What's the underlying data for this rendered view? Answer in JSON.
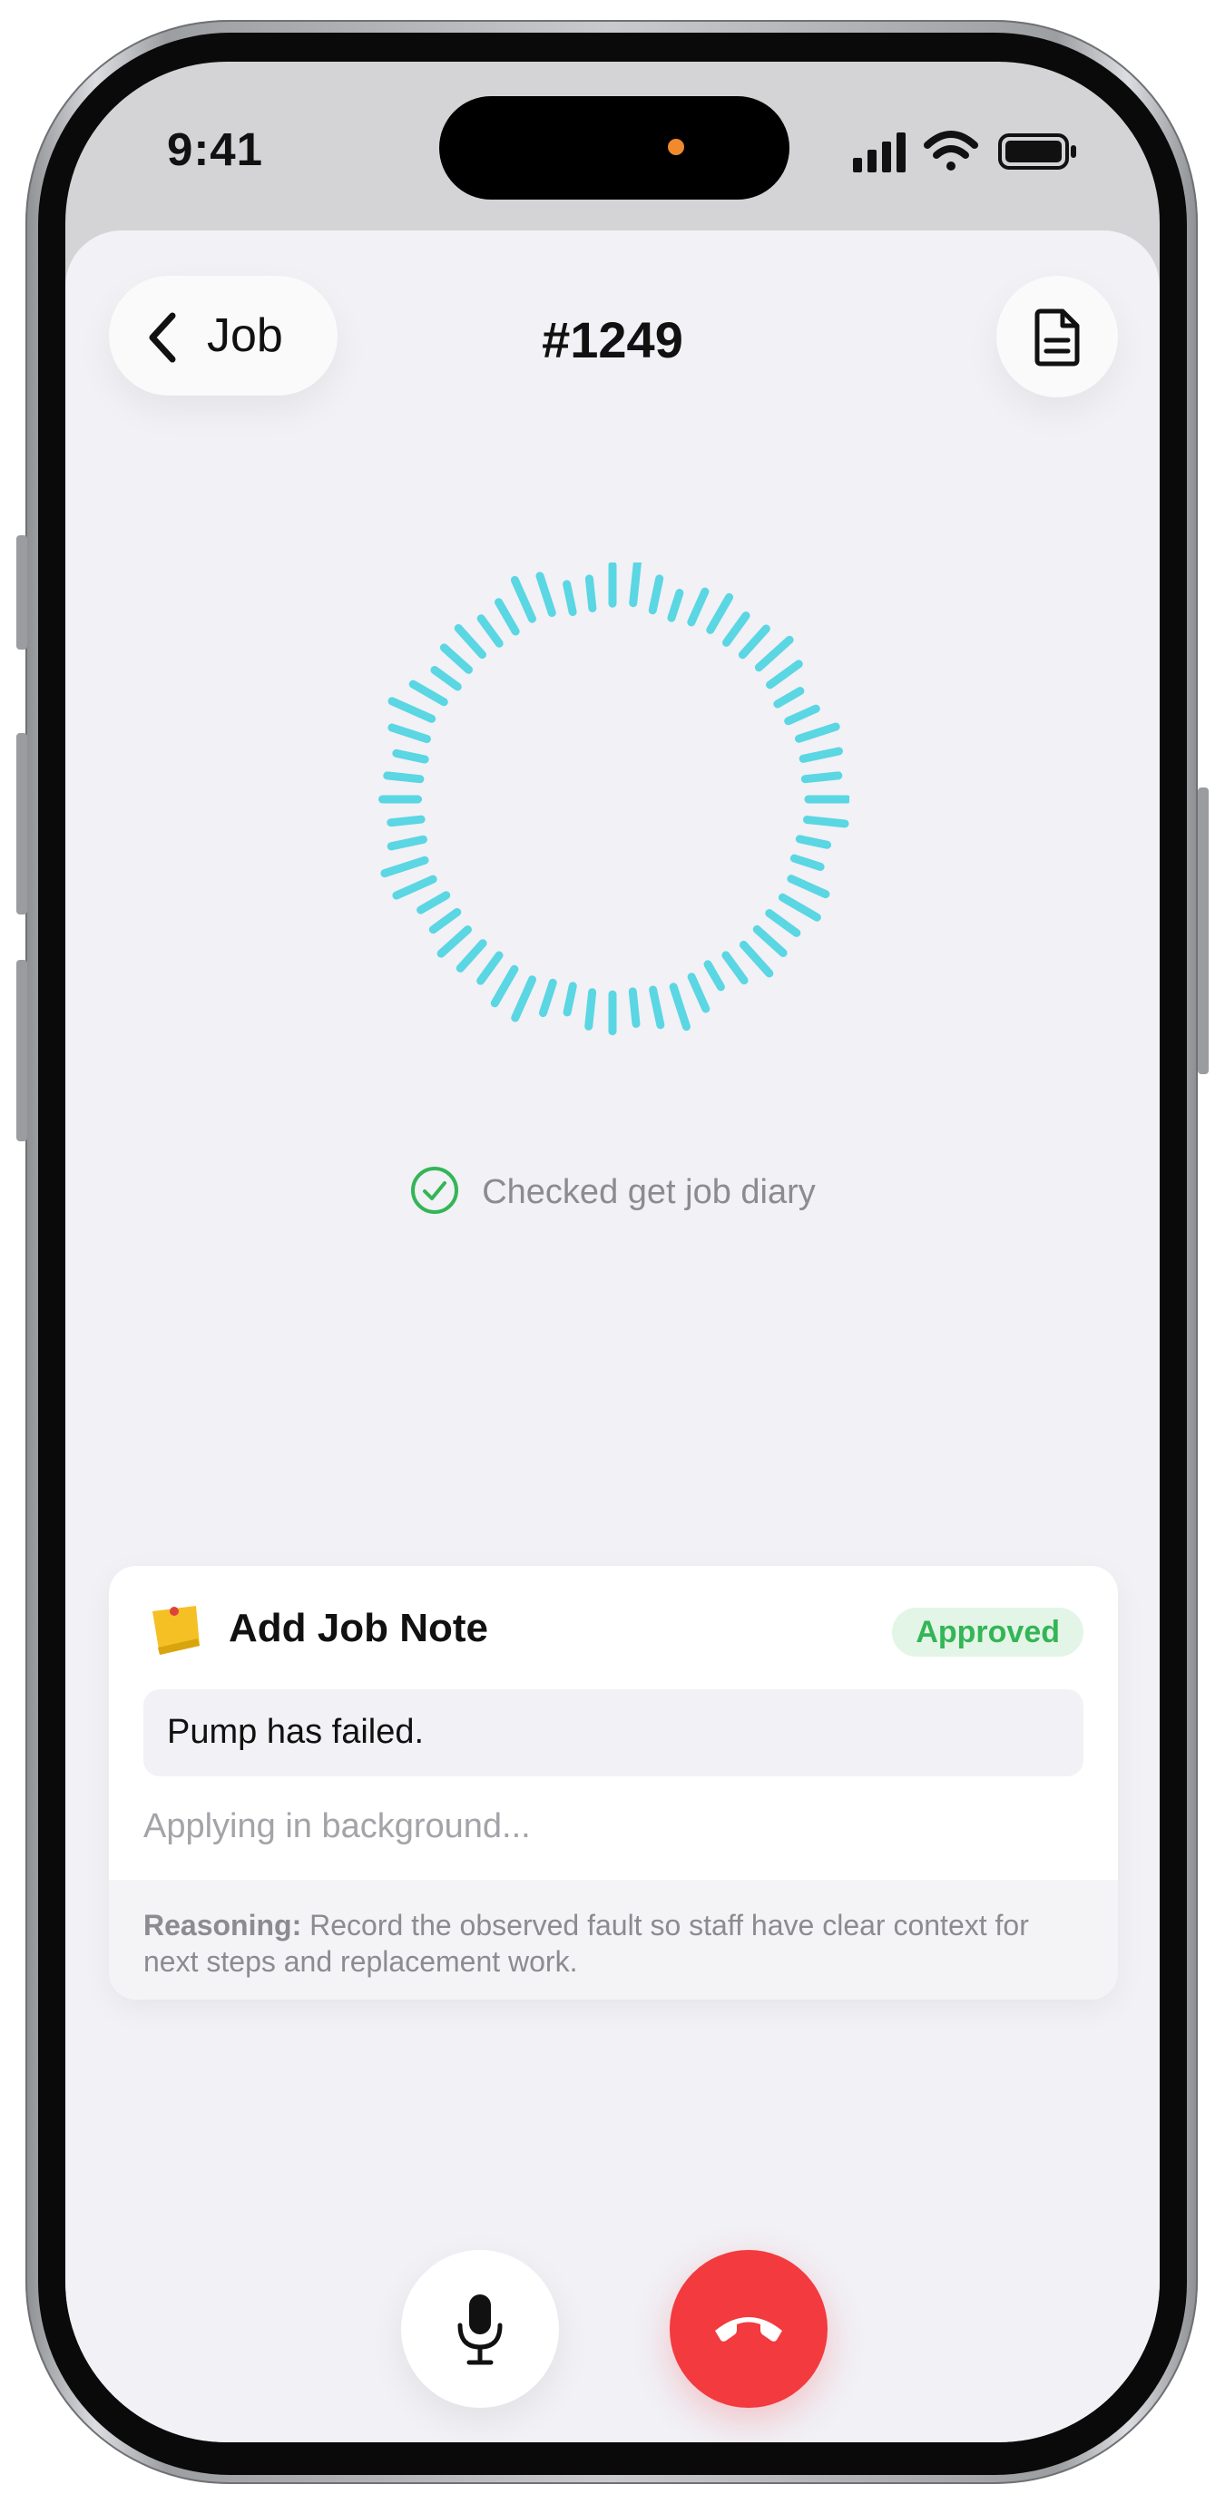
{
  "status_bar": {
    "time": "9:41",
    "icons": [
      "cellular-signal-icon",
      "wifi-icon",
      "battery-icon"
    ]
  },
  "header": {
    "back_label": "Job",
    "title": "#1249",
    "back_icon": "chevron-left-icon",
    "action_icon": "document-icon"
  },
  "activity": {
    "status_text": "Checked get job diary",
    "status_icon": "check-circle-icon",
    "accent_color": "#5bd6e3",
    "success_color": "#34b556"
  },
  "note_card": {
    "icon": "sticky-note-icon",
    "title": "Add Job Note",
    "badge": "Approved",
    "note_text": "Pump has failed.",
    "progress_text": "Applying in background...",
    "reasoning_label": "Reasoning:",
    "reasoning_text": "Record the observed fault so staff have clear context for next steps and replacement work."
  },
  "controls": {
    "mic_icon": "microphone-icon",
    "end_call_icon": "phone-hangup-icon",
    "end_call_color": "#f23a3f"
  }
}
